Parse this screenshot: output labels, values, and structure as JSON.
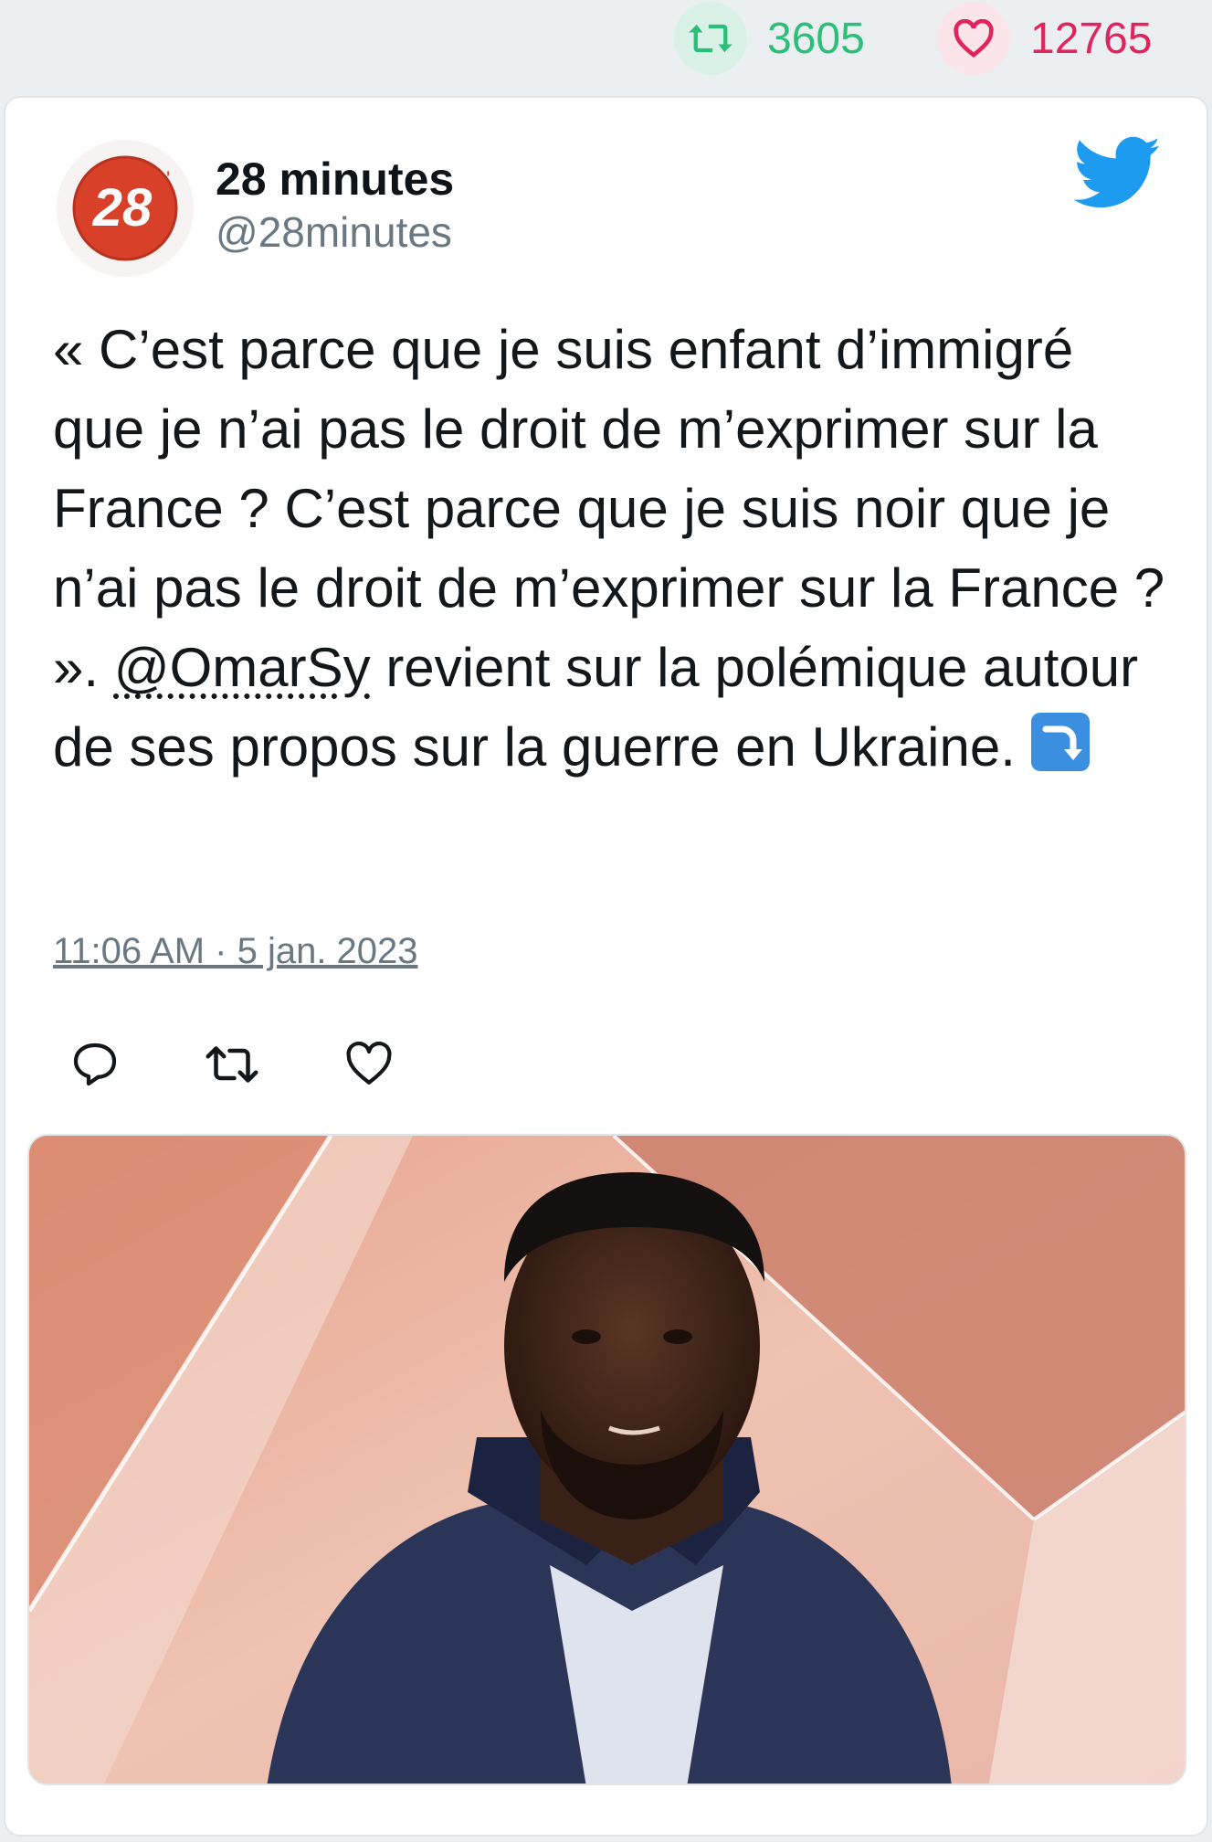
{
  "stats": {
    "retweet_count": "3605",
    "like_count": "12765"
  },
  "tweet": {
    "author_name": "28 minutes",
    "author_handle": "@28minutes",
    "avatar_text": "28",
    "text_part1": "« C’est parce que je suis enfant d’immigré que je n’ai pas le droit de m’exprimer sur la France ? C’est parce que je suis noir que je n’ai pas le droit de m’exprimer sur la France ? ». ",
    "mention": "@OmarSy",
    "text_part2": " revient sur la polémique autour de ses propos sur la guerre en Ukraine. ",
    "emoji": "↪",
    "timestamp": "11:06 AM · 5 jan. 2023"
  },
  "icons": {
    "retweet": "retweet-icon",
    "like": "heart-icon",
    "reply": "reply-icon",
    "brand": "twitter-bird-icon"
  },
  "colors": {
    "retweet_green": "#2bbf7a",
    "like_pink": "#e0245e",
    "twitter_blue": "#1d9bf0",
    "avatar_red": "#d8402a"
  }
}
